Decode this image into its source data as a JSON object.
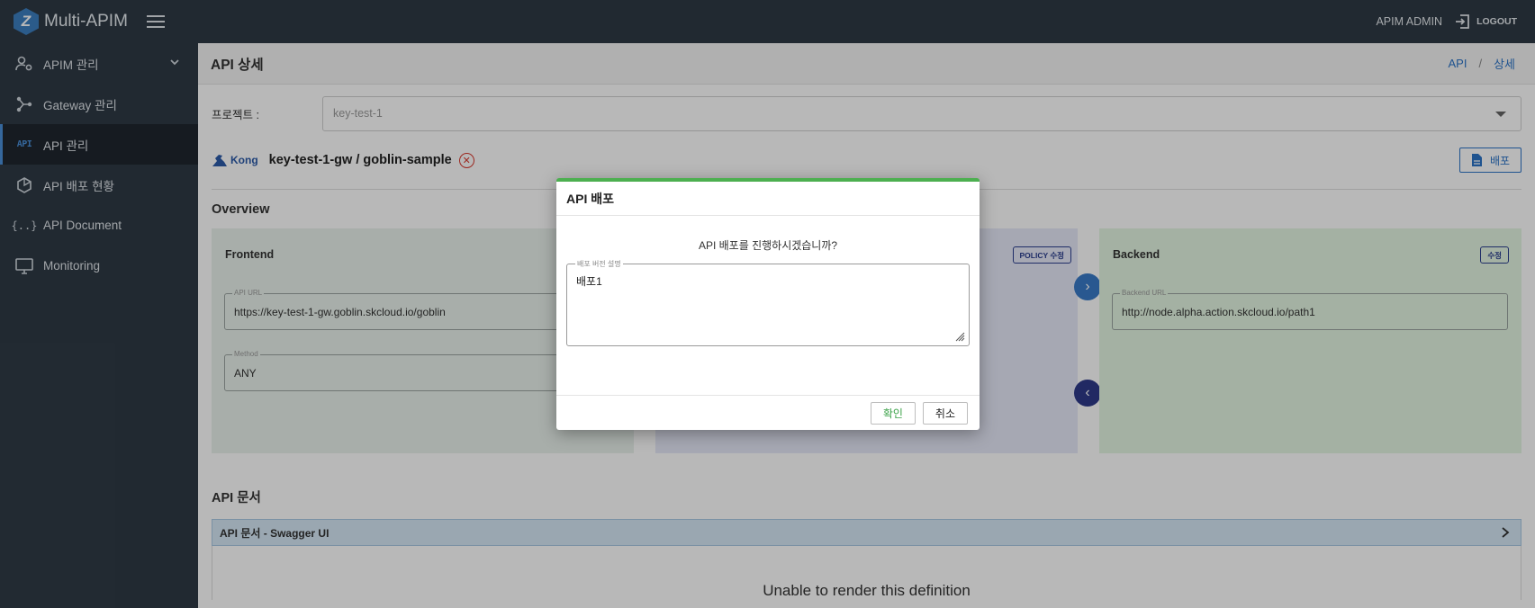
{
  "app": {
    "logo_letter": "Z",
    "title": "Multi-APIM"
  },
  "header": {
    "user": "APIM ADMIN",
    "logout": "LOGOUT"
  },
  "sidebar": {
    "items": [
      {
        "label": "APIM 관리",
        "icon": "user-gear-icon",
        "expandable": true
      },
      {
        "label": "Gateway 관리",
        "icon": "graph-nodes-icon"
      },
      {
        "label": "API 관리",
        "icon": "api-text-icon",
        "active": true,
        "icon_text": "API"
      },
      {
        "label": "API 배포 현황",
        "icon": "hexagon-icon"
      },
      {
        "label": "API Document",
        "icon": "braces-icon",
        "icon_text": "{..}"
      },
      {
        "label": "Monitoring",
        "icon": "monitor-icon"
      }
    ]
  },
  "page": {
    "title": "API 상세",
    "breadcrumb": [
      "API",
      "상세"
    ],
    "project_label": "프로젝트 :",
    "project_value": "key-test-1",
    "gateway_brand": "Kong",
    "gateway_name": "key-test-1-gw / goblin-sample",
    "deploy_label": "배포",
    "overview_title": "Overview",
    "frontend": {
      "title": "Frontend",
      "api_url_label": "API URL",
      "api_url": "https://key-test-1-gw.goblin.skcloud.io/goblin",
      "method_label": "Method",
      "method": "ANY"
    },
    "policy": {
      "edit_label": "POLICY 수정"
    },
    "backend": {
      "title": "Backend",
      "edit_label": "수정",
      "url_label": "Backend URL",
      "url": "http://node.alpha.action.skcloud.io/path1"
    },
    "doc_title": "API 문서",
    "doc_bar": "API 문서 - Swagger UI",
    "doc_error": "Unable to render this definition"
  },
  "dialog": {
    "title": "API 배포",
    "message": "API 배포를 진행하시겠습니까?",
    "field_label": "배포 버전 설명",
    "field_value": "배포1",
    "confirm": "확인",
    "cancel": "취소"
  },
  "colors": {
    "topbar": "#2f3a45",
    "accent": "#2c73c7",
    "dialog_top": "#4caf50",
    "frontend_panel": "#e9f2ec",
    "policy_panel": "#e7e9f8",
    "backend_panel": "#e4f6e2"
  }
}
